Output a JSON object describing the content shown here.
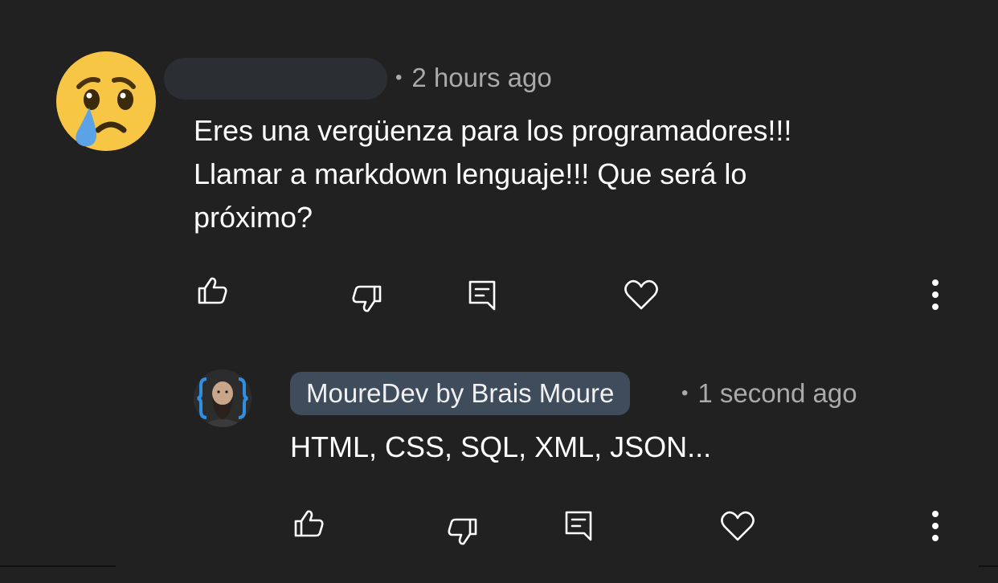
{
  "comment": {
    "avatar_icon": "crying-face-emoji",
    "time": "2 hours ago",
    "text": "Eres una vergüenza para los programadores!!!\nLlamar a markdown lenguaje!!! Que será lo\npróximo?",
    "actions": {
      "like_icon": "thumbs-up-icon",
      "dislike_icon": "thumbs-down-icon",
      "reply_icon": "reply-icon",
      "heart_icon": "heart-icon",
      "more_icon": "more-vertical-icon"
    }
  },
  "reply": {
    "author": "MoureDev by Brais Moure",
    "time": "1 second ago",
    "text": "HTML, CSS, SQL, XML, JSON...",
    "avatar_icon": "mouredev-avatar",
    "actions": {
      "like_icon": "thumbs-up-icon",
      "dislike_icon": "thumbs-down-icon",
      "reply_icon": "reply-icon",
      "heart_icon": "heart-icon",
      "more_icon": "more-vertical-icon"
    }
  },
  "colors": {
    "background": "#212121",
    "author_chip": "#3e4c5c",
    "meta_text": "#aaaaaa",
    "emoji_yellow": "#f7c645",
    "tear_blue": "#5ba3e6"
  }
}
